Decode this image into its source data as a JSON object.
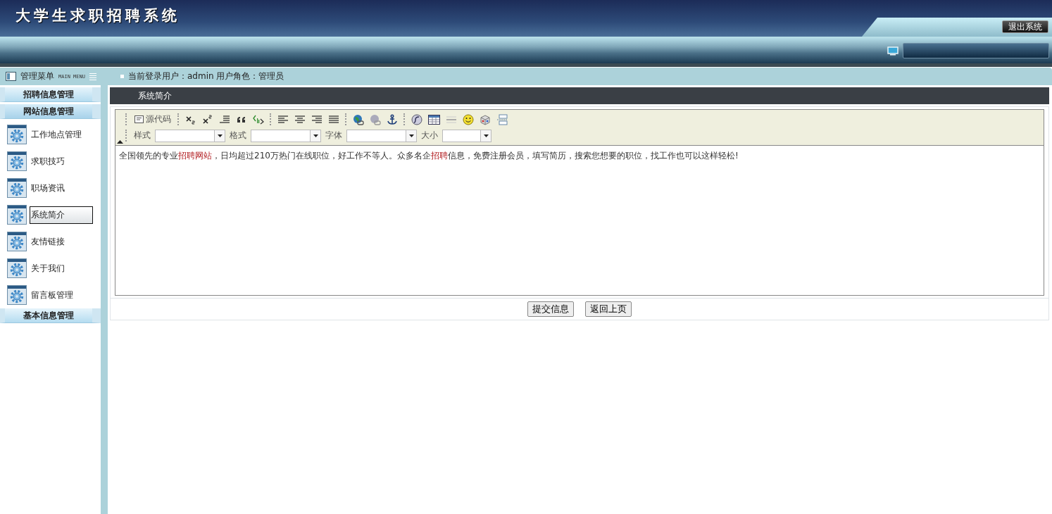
{
  "header": {
    "title": "大学生求职招聘系统",
    "logout_button": "退出系统"
  },
  "menu_bar": {
    "title": "管理菜单",
    "subtitle": "MAIN MENU",
    "user_info": "当前登录用户：admin  用户角色：管理员"
  },
  "sidebar": {
    "groups": [
      {
        "title": "招聘信息管理",
        "expanded": false
      },
      {
        "title": "网站信息管理",
        "expanded": true,
        "items": [
          {
            "label": "工作地点管理",
            "selected": false
          },
          {
            "label": "求职技巧",
            "selected": false
          },
          {
            "label": "职场资讯",
            "selected": false
          },
          {
            "label": "系统简介",
            "selected": true
          },
          {
            "label": "友情链接",
            "selected": false
          },
          {
            "label": "关于我们",
            "selected": false
          },
          {
            "label": "留言板管理",
            "selected": false
          }
        ]
      },
      {
        "title": "基本信息管理",
        "expanded": false
      }
    ]
  },
  "panel": {
    "title": "系统简介",
    "editor": {
      "source_button": "源代码",
      "dropdowns": [
        {
          "label": "样式"
        },
        {
          "label": "格式"
        },
        {
          "label": "字体"
        },
        {
          "label": "大小"
        }
      ],
      "content": [
        {
          "text": "全国领先的专业",
          "highlight": false
        },
        {
          "text": "招聘网站",
          "highlight": true
        },
        {
          "text": "，日均超过210万热门在线职位，好工作不等人。众多名企",
          "highlight": false
        },
        {
          "text": "招聘",
          "highlight": true
        },
        {
          "text": "信息，免费注册会员，填写简历，搜索您想要的职位，找工作也可以这样轻松!",
          "highlight": false
        }
      ]
    },
    "buttons": [
      "提交信息",
      "返回上页"
    ]
  }
}
